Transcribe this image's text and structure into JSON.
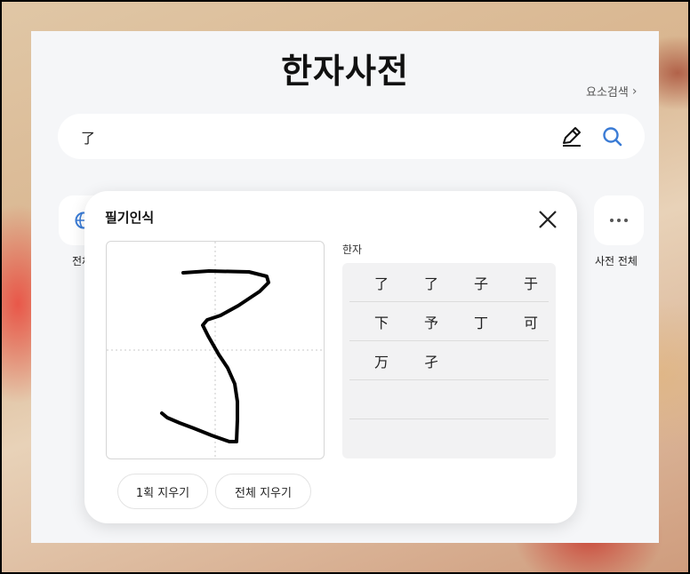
{
  "header": {
    "title": "한자사전",
    "element_search": "요소검색"
  },
  "search": {
    "value": "了",
    "placeholder": ""
  },
  "quick_links": {
    "left_label": "전체",
    "right_label": "사전 전체",
    "left_icon": "globe-icon",
    "right_icon": "more-dots-icon"
  },
  "handwriting": {
    "title": "필기인식",
    "candidates_label": "한자",
    "candidates": [
      [
        "了",
        "了",
        "子",
        "于"
      ],
      [
        "下",
        "予",
        "丁",
        "可"
      ],
      [
        "万",
        "孑"
      ],
      [],
      []
    ],
    "clear_one_label": "1획 지우기",
    "clear_all_label": "전체 지우기"
  },
  "colors": {
    "accent": "#3a7bd5",
    "panel_bg": "#f5f6f8",
    "candidate_bg": "#f2f2f3"
  }
}
